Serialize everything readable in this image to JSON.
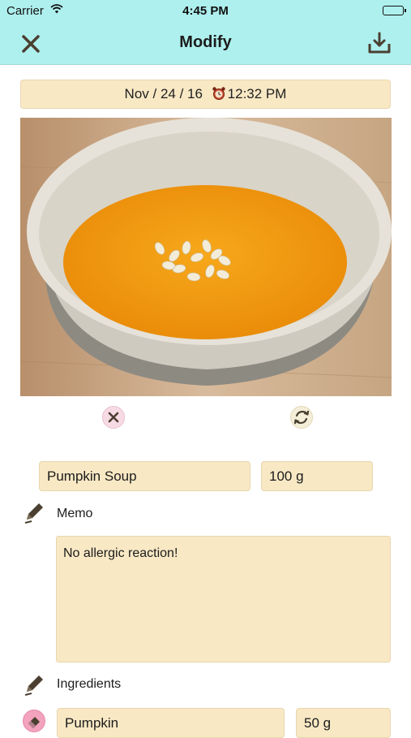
{
  "status": {
    "carrier": "Carrier",
    "time": "4:45 PM",
    "battery_level": 1.0
  },
  "nav": {
    "title": "Modify",
    "close_icon": "close-icon",
    "save_icon": "download-tray-icon"
  },
  "datetime": {
    "date": "Nov / 24 / 16",
    "time": "12:32 PM",
    "icon": "alarm-clock-icon"
  },
  "photo": {
    "subject": "pumpkin-soup-bowl"
  },
  "entry": {
    "name": "Pumpkin Soup",
    "amount": "100 g"
  },
  "memo": {
    "label": "Memo",
    "text": "No allergic reaction!"
  },
  "ingredients": {
    "label": "Ingredients",
    "items": [
      {
        "name": "Pumpkin",
        "amount": "50 g"
      }
    ]
  },
  "colors": {
    "nav_bg": "#aef0ee",
    "field_bg": "#f8e8c4",
    "remove_pink": "#f3a3bd"
  }
}
